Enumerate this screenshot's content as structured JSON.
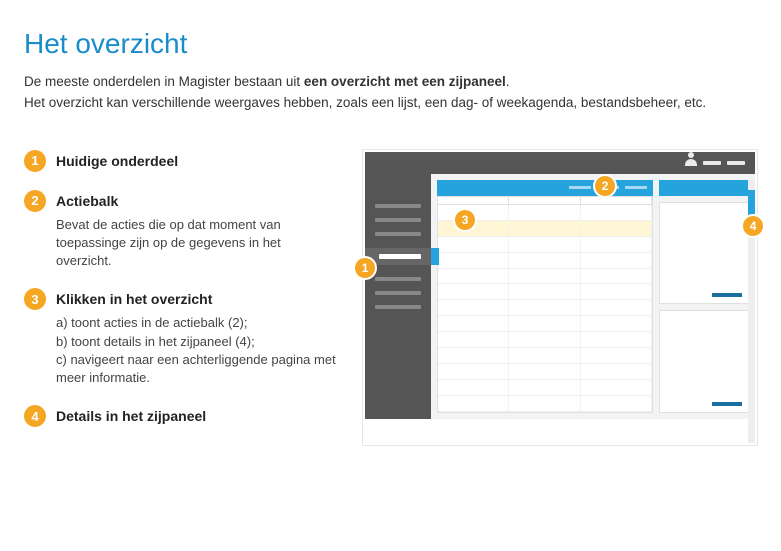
{
  "title": "Het overzicht",
  "intro": {
    "pre": "De meeste onderdelen in Magister bestaan uit ",
    "bold": "een overzicht met een zijpaneel",
    "post": ".",
    "line2": "Het overzicht kan verschillende weergaves hebben, zoals een lijst, een dag- of weekagenda, bestandsbeheer, etc."
  },
  "items": [
    {
      "num": "1",
      "title": "Huidige onderdeel",
      "body": []
    },
    {
      "num": "2",
      "title": "Actiebalk",
      "body": [
        "Bevat de acties die op dat moment van toepassinge zijn op de gegevens in het overzicht."
      ]
    },
    {
      "num": "3",
      "title": "Klikken in het overzicht",
      "body": [
        "a) toont acties in de actiebalk (2);",
        "b) toont details in het zijpaneel (4);",
        "c) navigeert naar een achterliggende pagina met meer informatie."
      ]
    },
    {
      "num": "4",
      "title": "Details in het zijpaneel",
      "body": []
    }
  ],
  "callouts": {
    "one": "1",
    "two": "2",
    "three": "3",
    "four": "4"
  }
}
